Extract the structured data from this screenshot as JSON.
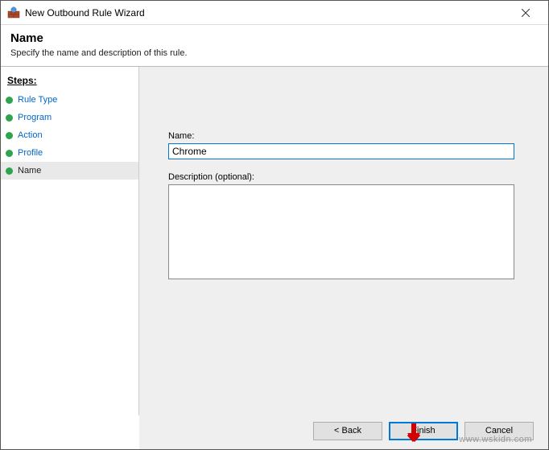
{
  "window": {
    "title": "New Outbound Rule Wizard"
  },
  "header": {
    "title": "Name",
    "subtitle": "Specify the name and description of this rule."
  },
  "sidebar": {
    "heading": "Steps:",
    "items": [
      {
        "label": "Rule Type",
        "state": "done"
      },
      {
        "label": "Program",
        "state": "done"
      },
      {
        "label": "Action",
        "state": "done"
      },
      {
        "label": "Profile",
        "state": "done"
      },
      {
        "label": "Name",
        "state": "current"
      }
    ]
  },
  "form": {
    "name_label": "Name:",
    "name_value": "Chrome",
    "description_label": "Description (optional):",
    "description_value": ""
  },
  "buttons": {
    "back": "< Back",
    "finish": "Finish",
    "cancel": "Cancel"
  },
  "watermark": "www.wskidn.com"
}
